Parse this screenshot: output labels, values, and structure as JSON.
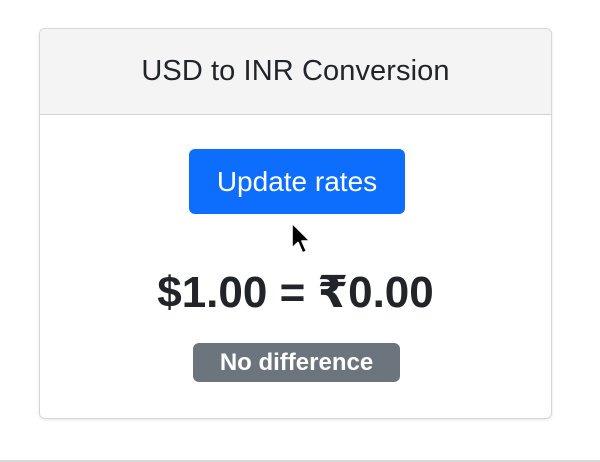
{
  "card": {
    "title": "USD to INR Conversion",
    "update_button_label": "Update rates",
    "conversion": {
      "usd_text": "$1.00",
      "equals": "=",
      "inr_text": "₹0.00"
    },
    "status_badge": "No difference"
  },
  "colors": {
    "primary_button": "#0d6efd",
    "badge_secondary": "#6c757d",
    "header_background": "#f4f4f5",
    "text": "#212529"
  },
  "icons": {
    "cursor": "mouse-pointer-icon"
  }
}
